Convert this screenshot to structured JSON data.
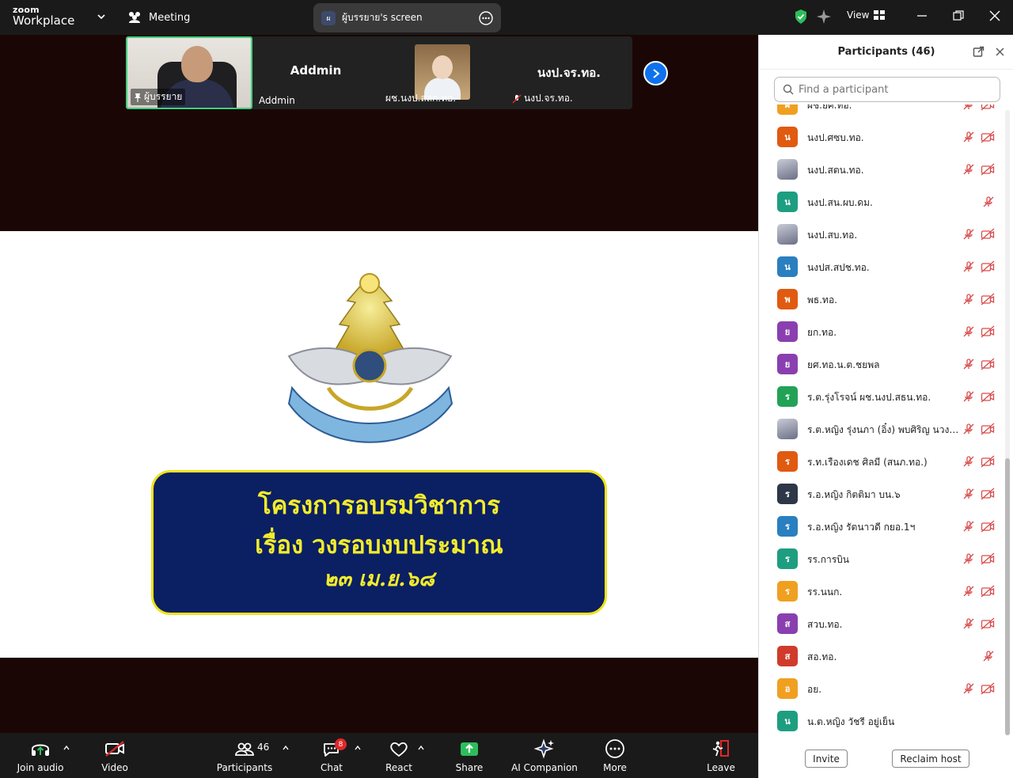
{
  "titlebar": {
    "logo_top": "zoom",
    "logo_bottom": "Workplace",
    "meeting_label": "Meeting",
    "share_avatar": "ผ",
    "share_label": "ผู้บรรยาย's screen",
    "view_label": "View"
  },
  "filmstrip": {
    "tiles": [
      {
        "name": "ผู้บรรยาย",
        "big": ""
      },
      {
        "name": "Addmin",
        "big": "Addmin"
      },
      {
        "name": "ผช.นงป.สลก.ทอ.",
        "big": ""
      },
      {
        "name": "นงป.จร.ทอ.",
        "big": "นงป.จร.ทอ."
      }
    ]
  },
  "slide": {
    "line1": "โครงการอบรมวิชาการ",
    "line2": "เรื่อง วงรอบงบประมาณ",
    "line3": "๒๓ เม.ย.๖๘"
  },
  "toolbar": {
    "join_audio": "Join audio",
    "video": "Video",
    "participants": "Participants",
    "participants_count": "46",
    "chat": "Chat",
    "chat_badge": "8",
    "react": "React",
    "share": "Share",
    "ai": "AI Companion",
    "more": "More",
    "leave": "Leave"
  },
  "panel": {
    "title": "Participants (46)",
    "search_placeholder": "Find a participant",
    "invite": "Invite",
    "reclaim": "Reclaim host",
    "participants": [
      {
        "initial": "ผ",
        "color": "#f0a020",
        "name": "ผช.ยศ.ทอ.",
        "cam": true
      },
      {
        "initial": "น",
        "color": "#e05a10",
        "name": "นงป.ศซบ.ทอ.",
        "cam": true
      },
      {
        "initial": "",
        "color": "photo",
        "name": "นงป.สตน.ทอ.",
        "cam": true
      },
      {
        "initial": "น",
        "color": "#1e9e80",
        "name": "นงป.สน.ผบ.ดม.",
        "cam": false
      },
      {
        "initial": "",
        "color": "photo",
        "name": "นงป.สบ.ทอ.",
        "cam": true
      },
      {
        "initial": "น",
        "color": "#2a7fc0",
        "name": "นงปส.สปช.ทอ.",
        "cam": true
      },
      {
        "initial": "พ",
        "color": "#e05a10",
        "name": "พธ.ทอ.",
        "cam": true
      },
      {
        "initial": "ย",
        "color": "#8a3fb0",
        "name": "ยก.ทอ.",
        "cam": true
      },
      {
        "initial": "ย",
        "color": "#8a3fb0",
        "name": "ยศ.ทอ.น.ต.ชยพล",
        "cam": true
      },
      {
        "initial": "ร",
        "color": "#21a257",
        "name": "ร.ต.รุ่งโรจน์ ผช.นงป.สธน.ทอ.",
        "cam": true
      },
      {
        "initial": "",
        "color": "photo",
        "name": "ร.ต.หญิง รุ่งนภา (อิ๋ง) พบศิริญ นวงป.สธน.ทอ.",
        "cam": true
      },
      {
        "initial": "ร",
        "color": "#e05a10",
        "name": "ร.ท.เรืองเดช ศิลมี (สนภ.ทอ.)",
        "cam": true
      },
      {
        "initial": "ร",
        "color": "#2d3748",
        "name": "ร.อ.หญิง กิตติมา บน.๖",
        "cam": true
      },
      {
        "initial": "ร",
        "color": "#2a7fc0",
        "name": "ร.อ.หญิง รัตนาวดี กยอ.1ฯ",
        "cam": true
      },
      {
        "initial": "ร",
        "color": "#1e9e80",
        "name": "รร.การบิน",
        "cam": true
      },
      {
        "initial": "ร",
        "color": "#f0a020",
        "name": "รร.นนก.",
        "cam": true
      },
      {
        "initial": "ส",
        "color": "#8a3fb0",
        "name": "สวบ.ทอ.",
        "cam": true
      },
      {
        "initial": "ส",
        "color": "#d03b2b",
        "name": "สอ.ทอ.",
        "cam": false
      },
      {
        "initial": "อ",
        "color": "#f0a020",
        "name": "อย.",
        "cam": true
      },
      {
        "initial": "น",
        "color": "#1e9e80",
        "name": "น.ต.หญิง วัชรี อยู่เย็น",
        "cam": null
      }
    ]
  }
}
